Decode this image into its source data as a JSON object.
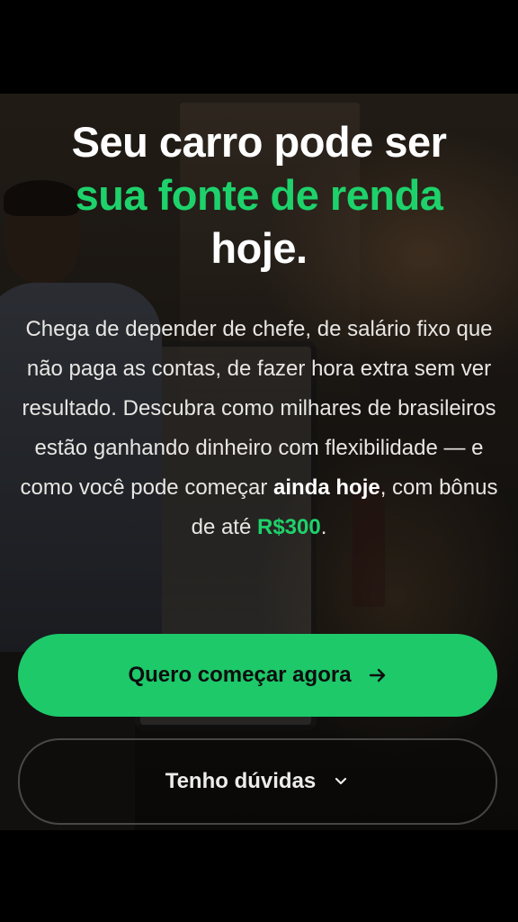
{
  "hero": {
    "headline": {
      "line1": "Seu carro pode ser",
      "line2": "sua fonte de renda",
      "line3": "hoje."
    },
    "body": {
      "intro": "Chega de depender de chefe, de salário fixo que não paga as contas, de fazer hora extra sem ver resultado. Descubra como milhares de brasileiros estão ganhando dinheiro com flexibilidade — e como você pode começar ",
      "highlight": "ainda hoje",
      "middle": ", com bônus de até ",
      "amount": "R$300",
      "end": "."
    }
  },
  "actions": {
    "primary_label": "Quero começar agora",
    "primary_icon": "arrow-right-icon",
    "secondary_label": "Tenho dúvidas",
    "secondary_icon": "chevron-down-icon"
  },
  "colors": {
    "accent": "#1ed26b",
    "primary_button": "#1ec96a",
    "text": "#ffffff"
  }
}
